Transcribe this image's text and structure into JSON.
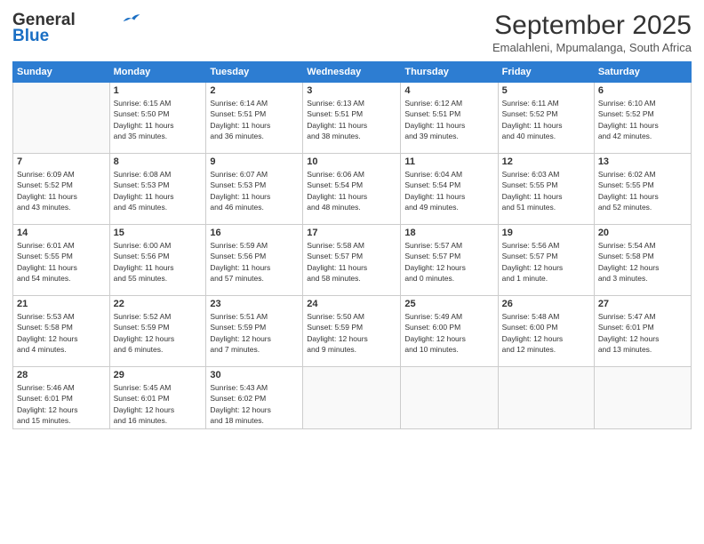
{
  "header": {
    "logo_general": "General",
    "logo_blue": "Blue",
    "month": "September 2025",
    "location": "Emalahleni, Mpumalanga, South Africa"
  },
  "days_of_week": [
    "Sunday",
    "Monday",
    "Tuesday",
    "Wednesday",
    "Thursday",
    "Friday",
    "Saturday"
  ],
  "weeks": [
    [
      {
        "day": "",
        "info": ""
      },
      {
        "day": "1",
        "info": "Sunrise: 6:15 AM\nSunset: 5:50 PM\nDaylight: 11 hours\nand 35 minutes."
      },
      {
        "day": "2",
        "info": "Sunrise: 6:14 AM\nSunset: 5:51 PM\nDaylight: 11 hours\nand 36 minutes."
      },
      {
        "day": "3",
        "info": "Sunrise: 6:13 AM\nSunset: 5:51 PM\nDaylight: 11 hours\nand 38 minutes."
      },
      {
        "day": "4",
        "info": "Sunrise: 6:12 AM\nSunset: 5:51 PM\nDaylight: 11 hours\nand 39 minutes."
      },
      {
        "day": "5",
        "info": "Sunrise: 6:11 AM\nSunset: 5:52 PM\nDaylight: 11 hours\nand 40 minutes."
      },
      {
        "day": "6",
        "info": "Sunrise: 6:10 AM\nSunset: 5:52 PM\nDaylight: 11 hours\nand 42 minutes."
      }
    ],
    [
      {
        "day": "7",
        "info": "Sunrise: 6:09 AM\nSunset: 5:52 PM\nDaylight: 11 hours\nand 43 minutes."
      },
      {
        "day": "8",
        "info": "Sunrise: 6:08 AM\nSunset: 5:53 PM\nDaylight: 11 hours\nand 45 minutes."
      },
      {
        "day": "9",
        "info": "Sunrise: 6:07 AM\nSunset: 5:53 PM\nDaylight: 11 hours\nand 46 minutes."
      },
      {
        "day": "10",
        "info": "Sunrise: 6:06 AM\nSunset: 5:54 PM\nDaylight: 11 hours\nand 48 minutes."
      },
      {
        "day": "11",
        "info": "Sunrise: 6:04 AM\nSunset: 5:54 PM\nDaylight: 11 hours\nand 49 minutes."
      },
      {
        "day": "12",
        "info": "Sunrise: 6:03 AM\nSunset: 5:55 PM\nDaylight: 11 hours\nand 51 minutes."
      },
      {
        "day": "13",
        "info": "Sunrise: 6:02 AM\nSunset: 5:55 PM\nDaylight: 11 hours\nand 52 minutes."
      }
    ],
    [
      {
        "day": "14",
        "info": "Sunrise: 6:01 AM\nSunset: 5:55 PM\nDaylight: 11 hours\nand 54 minutes."
      },
      {
        "day": "15",
        "info": "Sunrise: 6:00 AM\nSunset: 5:56 PM\nDaylight: 11 hours\nand 55 minutes."
      },
      {
        "day": "16",
        "info": "Sunrise: 5:59 AM\nSunset: 5:56 PM\nDaylight: 11 hours\nand 57 minutes."
      },
      {
        "day": "17",
        "info": "Sunrise: 5:58 AM\nSunset: 5:57 PM\nDaylight: 11 hours\nand 58 minutes."
      },
      {
        "day": "18",
        "info": "Sunrise: 5:57 AM\nSunset: 5:57 PM\nDaylight: 12 hours\nand 0 minutes."
      },
      {
        "day": "19",
        "info": "Sunrise: 5:56 AM\nSunset: 5:57 PM\nDaylight: 12 hours\nand 1 minute."
      },
      {
        "day": "20",
        "info": "Sunrise: 5:54 AM\nSunset: 5:58 PM\nDaylight: 12 hours\nand 3 minutes."
      }
    ],
    [
      {
        "day": "21",
        "info": "Sunrise: 5:53 AM\nSunset: 5:58 PM\nDaylight: 12 hours\nand 4 minutes."
      },
      {
        "day": "22",
        "info": "Sunrise: 5:52 AM\nSunset: 5:59 PM\nDaylight: 12 hours\nand 6 minutes."
      },
      {
        "day": "23",
        "info": "Sunrise: 5:51 AM\nSunset: 5:59 PM\nDaylight: 12 hours\nand 7 minutes."
      },
      {
        "day": "24",
        "info": "Sunrise: 5:50 AM\nSunset: 5:59 PM\nDaylight: 12 hours\nand 9 minutes."
      },
      {
        "day": "25",
        "info": "Sunrise: 5:49 AM\nSunset: 6:00 PM\nDaylight: 12 hours\nand 10 minutes."
      },
      {
        "day": "26",
        "info": "Sunrise: 5:48 AM\nSunset: 6:00 PM\nDaylight: 12 hours\nand 12 minutes."
      },
      {
        "day": "27",
        "info": "Sunrise: 5:47 AM\nSunset: 6:01 PM\nDaylight: 12 hours\nand 13 minutes."
      }
    ],
    [
      {
        "day": "28",
        "info": "Sunrise: 5:46 AM\nSunset: 6:01 PM\nDaylight: 12 hours\nand 15 minutes."
      },
      {
        "day": "29",
        "info": "Sunrise: 5:45 AM\nSunset: 6:01 PM\nDaylight: 12 hours\nand 16 minutes."
      },
      {
        "day": "30",
        "info": "Sunrise: 5:43 AM\nSunset: 6:02 PM\nDaylight: 12 hours\nand 18 minutes."
      },
      {
        "day": "",
        "info": ""
      },
      {
        "day": "",
        "info": ""
      },
      {
        "day": "",
        "info": ""
      },
      {
        "day": "",
        "info": ""
      }
    ]
  ]
}
